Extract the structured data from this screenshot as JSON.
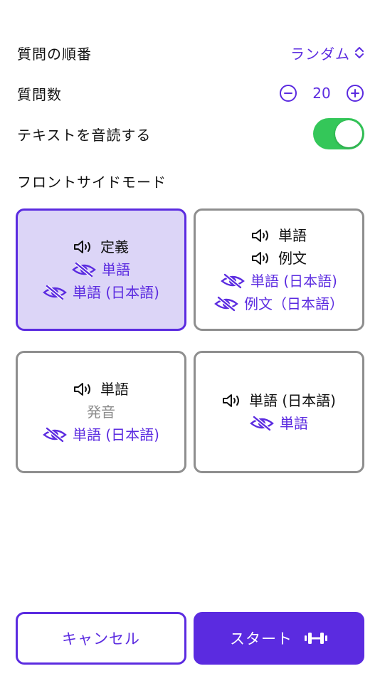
{
  "settings": {
    "order": {
      "label": "質問の順番",
      "value": "ランダム"
    },
    "count": {
      "label": "質問数",
      "value": "20"
    },
    "read_aloud": {
      "label": "テキストを音読する",
      "on": true
    }
  },
  "front_side": {
    "title": "フロントサイドモード",
    "modes": [
      {
        "lines": [
          {
            "kind": "speaker",
            "text": "定義"
          },
          {
            "kind": "hidden",
            "text": "単語"
          },
          {
            "kind": "hidden",
            "text": "単語 (日本語)"
          }
        ]
      },
      {
        "lines": [
          {
            "kind": "speaker",
            "text": "単語"
          },
          {
            "kind": "speaker",
            "text": "例文"
          },
          {
            "kind": "hidden",
            "text": "単語 (日本語)"
          },
          {
            "kind": "hidden",
            "text": "例文（日本語）"
          }
        ]
      },
      {
        "lines": [
          {
            "kind": "speaker",
            "text": "単語"
          },
          {
            "kind": "muted",
            "text": "発音"
          },
          {
            "kind": "hidden",
            "text": "単語 (日本語)"
          }
        ]
      },
      {
        "lines": [
          {
            "kind": "speaker",
            "text": "単語 (日本語)"
          },
          {
            "kind": "hidden",
            "text": "単語"
          }
        ]
      }
    ]
  },
  "actions": {
    "cancel": "キャンセル",
    "start": "スタート"
  },
  "icons": {
    "speaker": "speaker-icon",
    "hidden": "eye-slash-icon",
    "order_chevrons": "chevron-up-down-icon",
    "minus": "minus-circle-icon",
    "plus": "plus-circle-icon",
    "start": "dumbbell-icon"
  },
  "colors": {
    "accent": "#5B2BE0",
    "selected_bg": "#DCD5F7",
    "toggle_on": "#34C759",
    "border": "#8E8E8E"
  }
}
